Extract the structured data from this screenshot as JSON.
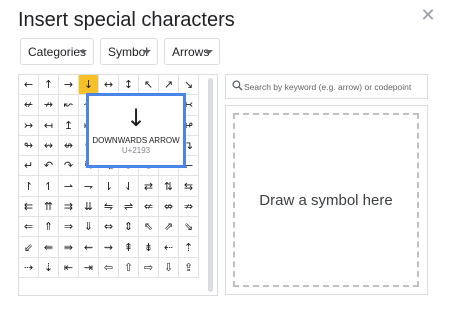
{
  "dialog": {
    "title": "Insert special characters",
    "close_icon": "close-icon"
  },
  "dropdowns": {
    "categories": "Categories",
    "symbol": "Symbol",
    "arrows": "Arrows"
  },
  "grid": {
    "selected_index": 3,
    "cells": [
      "←",
      "↑",
      "→",
      "↓",
      "↔",
      "↕",
      "↖",
      "↗",
      "↘",
      "↚",
      "↛",
      "↜",
      "↝",
      "↞",
      "↟",
      "↠",
      "↡",
      "↢",
      "↣",
      "↤",
      "↥",
      "↦",
      "↧",
      "↨",
      "↩",
      "↪",
      "↫",
      "↬",
      "↭",
      "↮",
      "↯",
      "↰",
      "↱",
      "↲",
      "↳",
      "↴",
      "↵",
      "↶",
      "↷",
      "↸",
      "↹",
      "↺",
      "↻",
      "↼",
      "↽",
      "↾",
      "↿",
      "⇀",
      "⇁",
      "⇂",
      "⇃",
      "⇄",
      "⇅",
      "⇆",
      "⇇",
      "⇈",
      "⇉",
      "⇊",
      "⇋",
      "⇌",
      "⇍",
      "⇎",
      "⇏",
      "⇐",
      "⇑",
      "⇒",
      "⇓",
      "⇔",
      "⇕",
      "⇖",
      "⇗",
      "⇘",
      "⇙",
      "⇚",
      "⇛",
      "⇜",
      "⇝",
      "⇞",
      "⇟",
      "⇠",
      "⇡",
      "⇢",
      "⇣",
      "⇤",
      "⇥",
      "⇦",
      "⇧",
      "⇨",
      "⇩",
      "⇪"
    ]
  },
  "preview": {
    "glyph": "↓",
    "name": "DOWNWARDS ARROW",
    "codepoint": "U+2193"
  },
  "search": {
    "placeholder": "Search by keyword (e.g. arrow) or codepoint",
    "value": ""
  },
  "draw": {
    "label": "Draw a symbol here"
  }
}
